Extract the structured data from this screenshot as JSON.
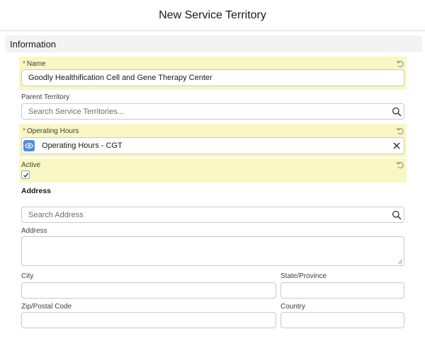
{
  "modal": {
    "title": "New Service Territory"
  },
  "section": {
    "title": "Information"
  },
  "fields": {
    "name": {
      "required_mark": "*",
      "label": "Name",
      "value": "Goodly Healthification Cell and Gene Therapy Center"
    },
    "parent_territory": {
      "label": "Parent Territory",
      "placeholder": "Search Service Territories..."
    },
    "operating_hours": {
      "required_mark": "*",
      "label": "Operating Hours",
      "value": "Operating Hours - CGT"
    },
    "active": {
      "label": "Active",
      "checked": true
    },
    "address_heading": "Address",
    "address_search": {
      "placeholder": "Search Address"
    },
    "address": {
      "label": "Address",
      "value": ""
    },
    "city": {
      "label": "City",
      "value": ""
    },
    "state": {
      "label": "State/Province",
      "value": ""
    },
    "zip": {
      "label": "Zip/Postal Code",
      "value": ""
    },
    "country": {
      "label": "Country",
      "value": ""
    }
  },
  "colors": {
    "highlight": "#f9f8c4",
    "required": "#c23934",
    "record_icon": "#5190d6"
  },
  "icons": [
    "undo-icon",
    "search-icon",
    "clear-icon",
    "eye-icon",
    "check-icon"
  ]
}
